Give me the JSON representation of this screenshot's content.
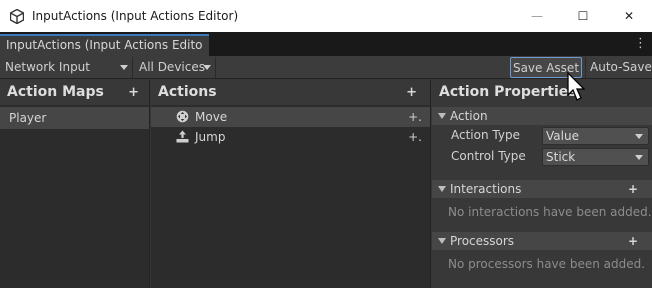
{
  "window": {
    "title": "InputActions (Input Actions Editor)",
    "minimize": "—",
    "maximize": "☐",
    "close": "✕"
  },
  "tab": {
    "label": "InputActions (Input Actions Edito",
    "menu_icon": "⋮"
  },
  "toolbar": {
    "scheme_select": "Network Input",
    "devices_select": "All Devices",
    "save_label": "Save Asset",
    "autosave_label": "Auto-Save"
  },
  "action_maps": {
    "header": "Action Maps",
    "add": "+",
    "items": [
      {
        "label": "Player",
        "selected": true
      }
    ]
  },
  "actions": {
    "header": "Actions",
    "add": "+",
    "items": [
      {
        "label": "Move",
        "icon": "move-action-icon",
        "add_binding": "+.",
        "selected": true
      },
      {
        "label": "Jump",
        "icon": "button-action-icon",
        "add_binding": "+.",
        "selected": false
      }
    ]
  },
  "properties": {
    "header": "Action Properties",
    "action_section": "Action",
    "action_type_label": "Action Type",
    "action_type_value": "Value",
    "control_type_label": "Control Type",
    "control_type_value": "Stick",
    "interactions_section": "Interactions",
    "interactions_add": "+",
    "interactions_empty": "No interactions have been added.",
    "processors_section": "Processors",
    "processors_add": "+",
    "processors_empty": "No processors have been added."
  },
  "colors": {
    "accent": "#3a79bb",
    "panel_bg": "#383838",
    "list_bg": "#2c2c2c",
    "selection_bg": "#464646",
    "titlebar_bg": "#ffffff"
  }
}
